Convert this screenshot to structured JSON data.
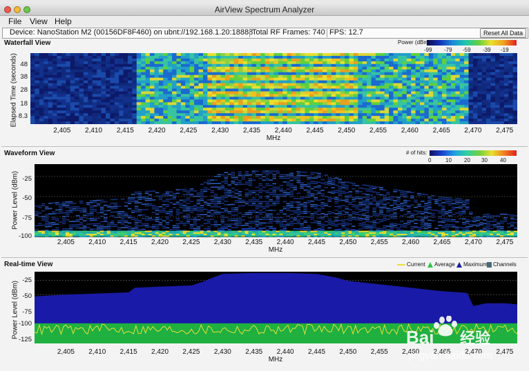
{
  "window": {
    "title": "AirView Spectrum Analyzer"
  },
  "menu": {
    "items": [
      "File",
      "View",
      "Help"
    ]
  },
  "infobar": {
    "device": "Device: NanoStation M2 (00156DF8F460) on ubnt://192.168.1.20:18888",
    "frames": "Total RF Frames: 740",
    "fps": "FPS: 12.7",
    "reset_label": "Reset All Data"
  },
  "axes": {
    "x_label": "MHz",
    "x_ticks": [
      "2,405",
      "2,410",
      "2,415",
      "2,420",
      "2,425",
      "2,430",
      "2,435",
      "2,440",
      "2,445",
      "2,450",
      "2,455",
      "2,460",
      "2,465",
      "2,470",
      "2,475"
    ]
  },
  "waterfall": {
    "title": "Waterfall View",
    "y_label": "Elapsed Time (seconds)",
    "y_ticks": [
      "48",
      "38",
      "28",
      "18",
      "8.3"
    ],
    "legend_title": "Power (dBm):",
    "legend_ticks": [
      "-99",
      "-79",
      "-59",
      "-39",
      "-19"
    ]
  },
  "waveform": {
    "title": "Waveform View",
    "y_label": "Power Level (dBm)",
    "y_ticks": [
      "-25",
      "-50",
      "-75",
      "-100"
    ],
    "legend_title": "# of hits:",
    "legend_ticks": [
      "0",
      "10",
      "20",
      "30",
      "40"
    ]
  },
  "realtime": {
    "title": "Real-time View",
    "y_label": "Power Level (dBm)",
    "y_ticks": [
      "-25",
      "-50",
      "-75",
      "-100",
      "-125"
    ],
    "legend": [
      {
        "label": "Current",
        "color": "#e8e03a"
      },
      {
        "label": "Average",
        "color": "#2fc44a"
      },
      {
        "label": "Maximum",
        "color": "#1a1aa8"
      },
      {
        "label": "Channels",
        "color": "#4a6a7a"
      }
    ]
  },
  "chart_data": [
    {
      "type": "heatmap",
      "title": "Waterfall View",
      "xlabel": "MHz",
      "ylabel": "Elapsed Time (seconds)",
      "xlim": [
        2400,
        2477
      ],
      "ylim": [
        0,
        55
      ],
      "colorbar": {
        "label": "Power (dBm):",
        "ticks": [
          -99,
          -79,
          -59,
          -39,
          -19
        ]
      },
      "regions": [
        {
          "x": [
            2400,
            2417
          ],
          "level": "low"
        },
        {
          "x": [
            2417,
            2428
          ],
          "level": "medium"
        },
        {
          "x": [
            2428,
            2452
          ],
          "level": "high"
        },
        {
          "x": [
            2452,
            2469
          ],
          "level": "medium"
        },
        {
          "x": [
            2469,
            2477
          ],
          "level": "low"
        }
      ]
    },
    {
      "type": "heatmap",
      "title": "Waveform View",
      "xlabel": "MHz",
      "ylabel": "Power Level (dBm)",
      "xlim": [
        2400,
        2477
      ],
      "ylim": [
        -100,
        -10
      ],
      "colorbar": {
        "label": "# of hits:",
        "ticks": [
          0,
          10,
          20,
          30,
          40
        ]
      }
    },
    {
      "type": "area",
      "title": "Real-time View",
      "xlabel": "MHz",
      "ylabel": "Power Level (dBm)",
      "xlim": [
        2400,
        2477
      ],
      "ylim": [
        -135,
        -10
      ],
      "series": [
        {
          "name": "Maximum",
          "x": [
            2400,
            2405,
            2410,
            2415,
            2416,
            2420,
            2425,
            2427,
            2428,
            2430,
            2435,
            2440,
            2445,
            2448,
            2450,
            2455,
            2460,
            2465,
            2469,
            2470,
            2472,
            2475,
            2477
          ],
          "values": [
            -53,
            -50,
            -48,
            -46,
            -38,
            -36,
            -34,
            -27,
            -22,
            -14,
            -12,
            -12,
            -14,
            -20,
            -26,
            -32,
            -38,
            -44,
            -47,
            -70,
            -65,
            -65,
            -67
          ]
        },
        {
          "name": "Average",
          "x": [
            2400,
            2477
          ],
          "values": [
            -100,
            -100
          ]
        },
        {
          "name": "Current",
          "x": [
            2400,
            2477
          ],
          "values": [
            -110,
            -110
          ]
        }
      ]
    }
  ]
}
